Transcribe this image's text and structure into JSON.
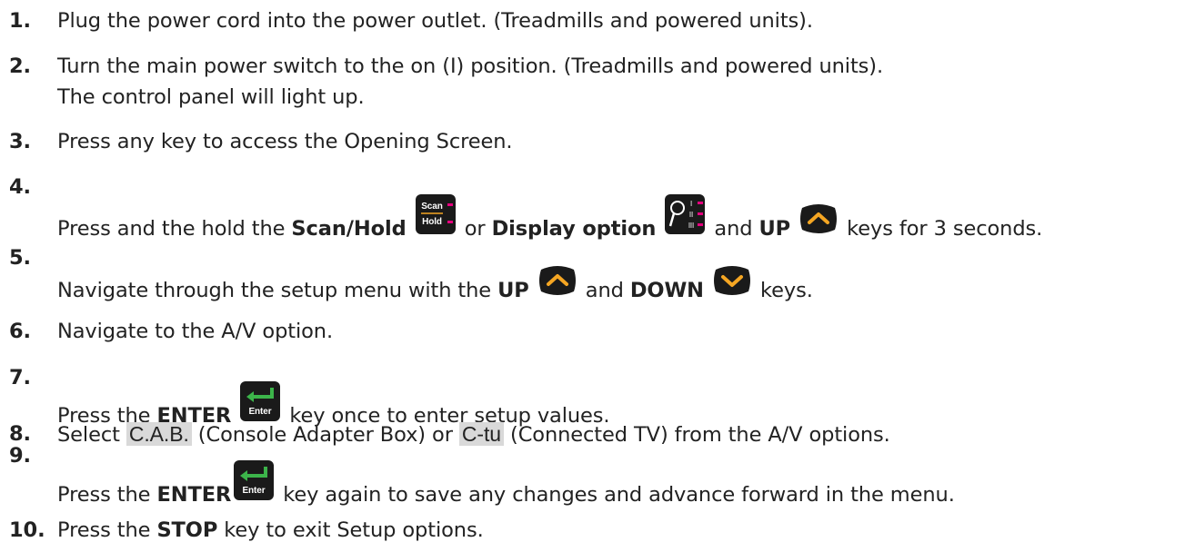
{
  "steps": [
    {
      "num": "1.",
      "text": "Plug the power cord into the power outlet. (Treadmills and powered units)."
    },
    {
      "num": "2.",
      "line1": "Turn the main power switch to the on (I) position. (Treadmills and powered units).",
      "line2": "The control panel will light up."
    },
    {
      "num": "3.",
      "text": "Press any key to access the Opening Screen."
    },
    {
      "num": "4.",
      "a": "Press and the hold the ",
      "b1": "Scan/Hold",
      "c": " or ",
      "b2": "Display option",
      "d": " and ",
      "b3": "UP",
      "e": " keys for 3 seconds."
    },
    {
      "num": "5.",
      "a": "Navigate through the setup menu with the ",
      "b1": "UP",
      "c": " and ",
      "b2": "DOWN",
      "d": " keys."
    },
    {
      "num": "6.",
      "text": "Navigate to the A/V option."
    },
    {
      "num": "7.",
      "a": "Press the ",
      "b1": "ENTER",
      "c": " key once to enter setup values."
    },
    {
      "num": "8.",
      "a": "Select ",
      "v1": "C.A.B.",
      "b": " (Console Adapter Box) or ",
      "v2": "C-tu",
      "c": " (Connected TV) from the A/V options."
    },
    {
      "num": "9.",
      "a": "Press the ",
      "b1": "ENTER",
      "c": " key again to save any changes and advance forward in the menu."
    },
    {
      "num": "10.",
      "a": "Press the ",
      "b1": "STOP",
      "c": " key to exit Setup options."
    }
  ],
  "keys": {
    "scan_top": "Scan",
    "scan_bottom": "Hold",
    "enter_label": "Enter"
  },
  "colors": {
    "key_bg": "#1a1a1a",
    "indicator": "#e6007e",
    "arrow": "#f5a623",
    "enter_arrow": "#3cb44a",
    "lcd_bg": "#d9d9d9"
  }
}
